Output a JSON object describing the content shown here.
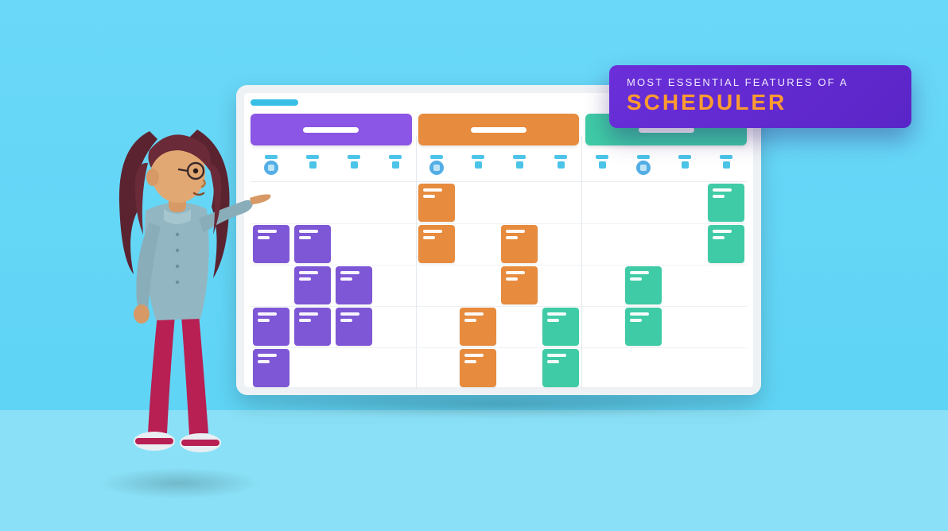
{
  "badge": {
    "line1": "Most Essential Features of a",
    "line2": "Scheduler"
  },
  "colors": {
    "purple": "#7e57d6",
    "orange": "#e78b3e",
    "teal": "#3fcba6",
    "badge_bg": "#5a25c7",
    "badge_accent": "#ff9b2f"
  },
  "board": {
    "groups": [
      "purple",
      "orange",
      "teal"
    ],
    "columns_per_group": 4,
    "rows": 5,
    "date_highlights": [
      1,
      5,
      10
    ],
    "events": [
      {
        "col": 1,
        "row": 2,
        "color": "purple"
      },
      {
        "col": 2,
        "row": 2,
        "color": "purple"
      },
      {
        "col": 2,
        "row": 3,
        "color": "purple"
      },
      {
        "col": 1,
        "row": 4,
        "color": "purple"
      },
      {
        "col": 2,
        "row": 4,
        "color": "purple"
      },
      {
        "col": 3,
        "row": 4,
        "color": "purple"
      },
      {
        "col": 1,
        "row": 5,
        "color": "purple"
      },
      {
        "col": 3,
        "row": 3,
        "color": "purple"
      },
      {
        "col": 5,
        "row": 1,
        "color": "orange"
      },
      {
        "col": 5,
        "row": 2,
        "color": "orange"
      },
      {
        "col": 7,
        "row": 2,
        "color": "orange"
      },
      {
        "col": 7,
        "row": 3,
        "color": "orange"
      },
      {
        "col": 6,
        "row": 4,
        "color": "orange"
      },
      {
        "col": 6,
        "row": 5,
        "color": "orange"
      },
      {
        "col": 8,
        "row": 4,
        "color": "teal"
      },
      {
        "col": 8,
        "row": 5,
        "color": "teal"
      },
      {
        "col": 10,
        "row": 3,
        "color": "teal"
      },
      {
        "col": 10,
        "row": 4,
        "color": "teal"
      },
      {
        "col": 12,
        "row": 1,
        "color": "teal"
      },
      {
        "col": 12,
        "row": 2,
        "color": "teal"
      }
    ]
  }
}
